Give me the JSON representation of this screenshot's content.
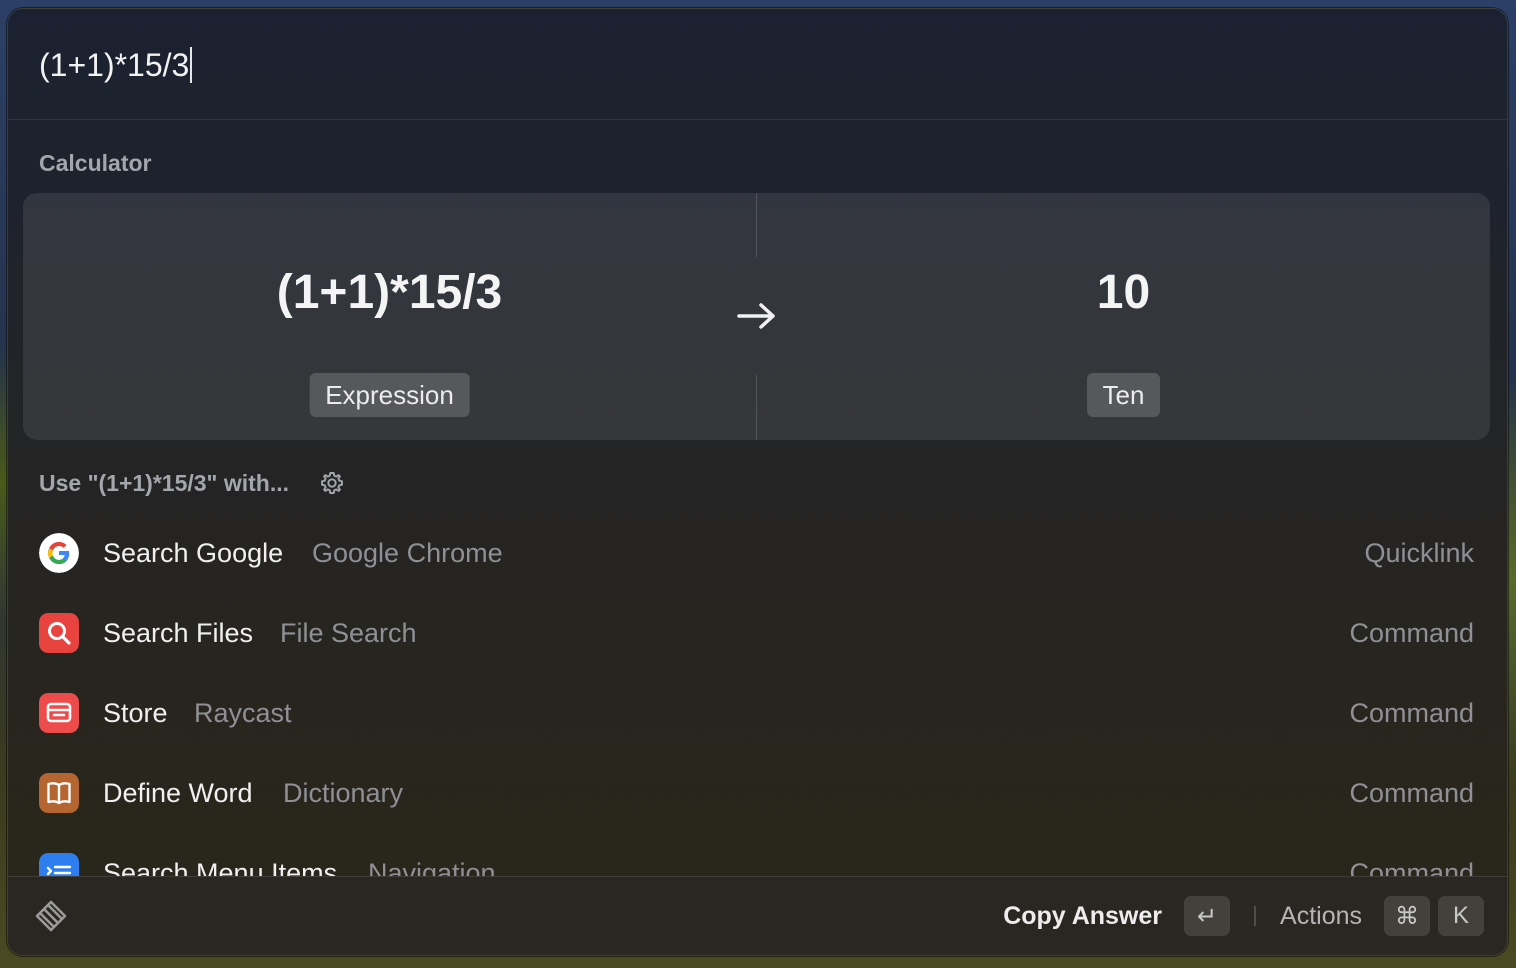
{
  "search": {
    "query": "(1+1)*15/3"
  },
  "calculator": {
    "section_title": "Calculator",
    "expression": "(1+1)*15/3",
    "expression_label": "Expression",
    "result": "10",
    "result_label": "Ten"
  },
  "use_with": {
    "label": "Use \"(1+1)*15/3\" with..."
  },
  "results": [
    {
      "title": "Search Google",
      "subtitle": "Google Chrome",
      "accessory": "Quicklink",
      "icon": "google-icon"
    },
    {
      "title": "Search Files",
      "subtitle": "File Search",
      "accessory": "Command",
      "icon": "search-files-icon",
      "color": "#e8433f"
    },
    {
      "title": "Store",
      "subtitle": "Raycast",
      "accessory": "Command",
      "icon": "store-icon",
      "color": "#ee4b4b"
    },
    {
      "title": "Define Word",
      "subtitle": "Dictionary",
      "accessory": "Command",
      "icon": "dictionary-icon",
      "color": "#b5652f"
    },
    {
      "title": "Search Menu Items",
      "subtitle": "Navigation",
      "accessory": "Command",
      "icon": "menu-items-icon",
      "color": "#2d7ff0"
    }
  ],
  "footer": {
    "primary_action": "Copy Answer",
    "primary_key": "↵",
    "secondary_action": "Actions",
    "keys": [
      "⌘",
      "K"
    ]
  }
}
